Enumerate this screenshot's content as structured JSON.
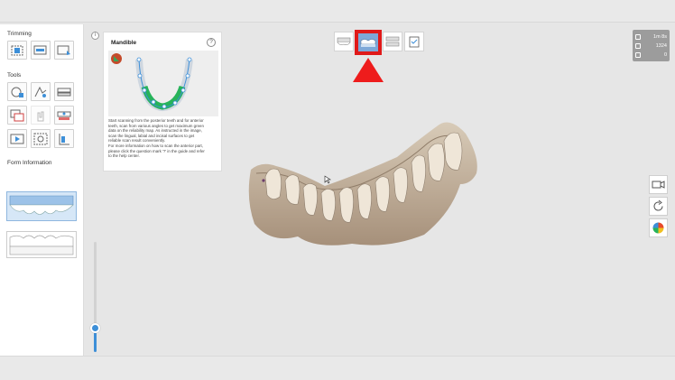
{
  "sidebar": {
    "trimming_title": "Trimming",
    "tools_title": "Tools",
    "form_info_title": "Form Information",
    "trimming_tools": [
      {
        "icon": "area-select-icon",
        "name": "trim-area-tool"
      },
      {
        "icon": "screen-trim-icon",
        "name": "trim-screen-tool"
      },
      {
        "icon": "trim-down-icon",
        "name": "trim-down-tool"
      }
    ],
    "tools": [
      {
        "icon": "lock-sphere-icon",
        "name": "lock-tool",
        "disabled": false
      },
      {
        "icon": "brush-icon",
        "name": "brush-tool",
        "disabled": false
      },
      {
        "icon": "jaw-scan-icon",
        "name": "jaw-tool",
        "disabled": false
      },
      {
        "icon": "image-layer-icon",
        "name": "image-layer-tool",
        "disabled": false
      },
      {
        "icon": "hand-icon",
        "name": "hand-tool",
        "disabled": true
      },
      {
        "icon": "tooth-mark-icon",
        "name": "tooth-mark-tool",
        "disabled": false
      },
      {
        "icon": "play-video-icon",
        "name": "video-tool",
        "disabled": false
      },
      {
        "icon": "camera-capture-icon",
        "name": "capture-tool",
        "disabled": false
      },
      {
        "icon": "section-view-icon",
        "name": "section-tool",
        "disabled": false
      }
    ]
  },
  "guide": {
    "info_label": "i",
    "title": "Mandible",
    "help_label": "?",
    "text": [
      "Start scanning from the posterior teeth and for anterior",
      "teeth, scan from various angles to get maximum green",
      "data on the reliability map. As instructed in the image,",
      "scan the lingual, labial and incisal surfaces to get",
      "reliable scan result conveniently.",
      "For more information on how to scan the anterior part,",
      "please click the question mark '?' in the guide and refer",
      "to the help center."
    ]
  },
  "steps": [
    {
      "name": "step-maxilla",
      "icon": "maxilla-icon"
    },
    {
      "name": "step-mandible",
      "icon": "mandible-icon",
      "active": true
    },
    {
      "name": "step-occlusion",
      "icon": "occlusion-icon"
    },
    {
      "name": "step-complete",
      "icon": "checklist-icon"
    }
  ],
  "scan_info": {
    "time": "1m 8s",
    "frames": "1324",
    "count": "0"
  },
  "right_tools": [
    {
      "name": "record-video-button",
      "icon": "video-camera-icon"
    },
    {
      "name": "reset-view-button",
      "icon": "refresh-icon"
    },
    {
      "name": "reliability-map-button",
      "icon": "color-map-icon"
    }
  ],
  "slider": {
    "value": 0.2
  },
  "colors": {
    "accent": "#3d8fd8",
    "highlight": "#e01a1a",
    "scan_info_bg": "#9c9c9c",
    "reliability_green": "#27b35a",
    "tooth": "#cbbba8"
  }
}
